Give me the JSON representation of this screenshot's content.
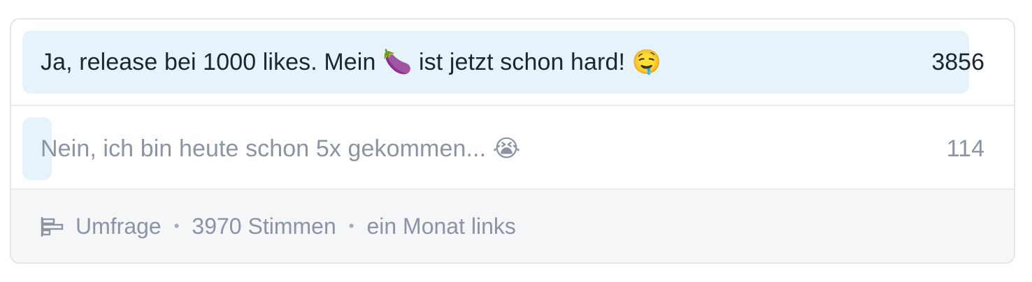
{
  "poll": {
    "options": [
      {
        "label": "Ja, release bei 1000 likes. Mein 🍆 ist jetzt schon hard! 🤤",
        "votes": "3856",
        "share": 0.971
      },
      {
        "label": "Nein, ich bin heute schon 5x gekommen... 😭",
        "votes": "114",
        "share": 0.029
      }
    ],
    "footer": {
      "type_label": "Umfrage",
      "separator": "•",
      "total_votes": "3970 Stimmen",
      "time_left": "ein Monat links"
    },
    "icon": "poll-icon"
  },
  "colors": {
    "bar_fill": "#e6f3fb",
    "text_primary": "#1d2530",
    "text_muted": "#8a94a3",
    "footer_bg": "#f5f6f8",
    "border": "#e3e5e9"
  }
}
